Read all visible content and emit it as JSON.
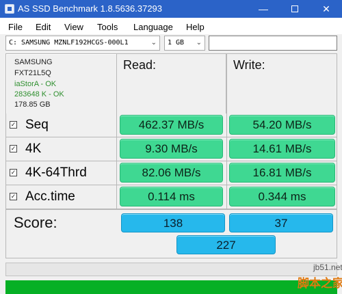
{
  "window": {
    "title": "AS SSD Benchmark 1.8.5636.37293",
    "minimize": "—",
    "close": "✕"
  },
  "menu": [
    "File",
    "Edit",
    "View",
    "Tools",
    "Language",
    "Help"
  ],
  "toolbar": {
    "drive": "C: SAMSUNG MZNLF192HCGS-000L1",
    "size": "1 GB",
    "search_value": ""
  },
  "drive_info": {
    "model": "SAMSUNG",
    "firmware": "FXT21L5Q",
    "driver_status": "iaStorA - OK",
    "alignment_status": "283648 K - OK",
    "capacity": "178.85 GB"
  },
  "columns": {
    "read": "Read:",
    "write": "Write:"
  },
  "tests": [
    {
      "name": "Seq",
      "checked": true,
      "read": "462.37 MB/s",
      "write": "54.20 MB/s"
    },
    {
      "name": "4K",
      "checked": true,
      "read": "9.30 MB/s",
      "write": "14.61 MB/s"
    },
    {
      "name": "4K-64Thrd",
      "checked": true,
      "read": "82.06 MB/s",
      "write": "16.81 MB/s"
    },
    {
      "name": "Acc.time",
      "checked": true,
      "read": "0.114 ms",
      "write": "0.344 ms"
    }
  ],
  "score": {
    "label": "Score:",
    "read": "138",
    "write": "37",
    "total": "227"
  },
  "progress": {
    "percent": 100
  },
  "colors": {
    "title_bar": "#2b63c8",
    "value_pill": "#3fd892",
    "score_pill": "#26b8ec",
    "progress": "#06b025",
    "ok_text": "#2f8f2f"
  },
  "watermark": {
    "site": "jb51.net",
    "name": "脚本之家"
  }
}
